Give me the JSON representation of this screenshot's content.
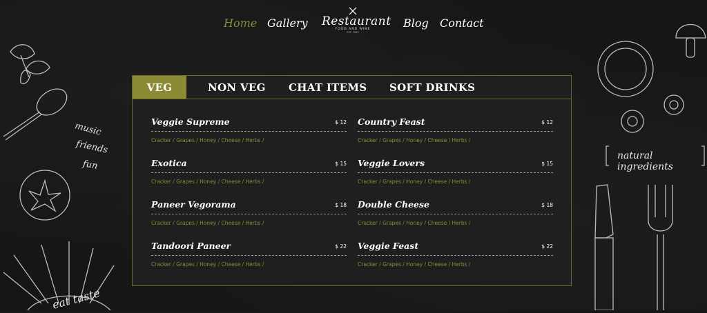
{
  "nav": {
    "items": [
      {
        "label": "Home",
        "active": true
      },
      {
        "label": "Gallery",
        "active": false
      },
      {
        "label": "Blog",
        "active": false
      },
      {
        "label": "Contact",
        "active": false
      }
    ],
    "logo": {
      "title": "Restaurant",
      "subtitle": "FOOD AND WINE",
      "est": "EST. 1985"
    }
  },
  "decor": {
    "left_words": [
      "music",
      "friends",
      "fun"
    ],
    "left_bottom": "eat taste",
    "right_banner": "natural ingredients"
  },
  "menu": {
    "tabs": [
      {
        "label": "VEG",
        "active": true
      },
      {
        "label": "NON VEG",
        "active": false
      },
      {
        "label": "CHAT ITEMS",
        "active": false
      },
      {
        "label": "SOFT DRINKS",
        "active": false
      }
    ],
    "items": [
      {
        "name": "Veggie Supreme",
        "price": "$ 12",
        "ingredients": "Cracker / Grapes / Honey / Cheese / Herbs /"
      },
      {
        "name": "Country Feast",
        "price": "$ 12",
        "ingredients": "Cracker / Grapes / Honey / Cheese / Herbs /"
      },
      {
        "name": "Exotica",
        "price": "$ 15",
        "ingredients": "Cracker / Grapes / Honey / Cheese / Herbs /"
      },
      {
        "name": "Veggie Lovers",
        "price": "$ 15",
        "ingredients": "Cracker / Grapes / Honey / Cheese / Herbs /"
      },
      {
        "name": "Paneer Vegorama",
        "price": "$ 18",
        "ingredients": "Cracker / Grapes / Honey / Cheese / Herbs /"
      },
      {
        "name": "Double Cheese",
        "price": "$ 18",
        "ingredients": "Cracker / Grapes / Honey / Cheese / Herbs /"
      },
      {
        "name": "Tandoori Paneer",
        "price": "$ 22",
        "ingredients": "Cracker / Grapes / Honey / Cheese / Herbs /"
      },
      {
        "name": "Veggie Feast",
        "price": "$ 22",
        "ingredients": "Cracker / Grapes / Honey / Cheese / Herbs /"
      }
    ]
  },
  "colors": {
    "accent": "#8b8a35",
    "background": "#161616",
    "panel": "#1f1f1f"
  }
}
